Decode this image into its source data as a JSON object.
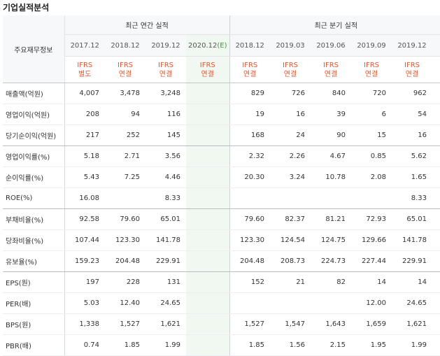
{
  "title": "기업실적분석",
  "header": {
    "rowhead": "주요재무정보",
    "annual_label": "최근 연간 실적",
    "quarter_label": "최근 분기 실적",
    "periods": [
      "2017.12",
      "2018.12",
      "2019.12",
      "2020.12",
      "2018.12",
      "2019.03",
      "2019.06",
      "2019.09",
      "2019.12"
    ],
    "est_mark": "(E)",
    "acc_top": "IFRS",
    "accounts": [
      "별도",
      "연결",
      "연결",
      "연결",
      "연결",
      "연결",
      "연결",
      "연결",
      "연결"
    ]
  },
  "rows": [
    {
      "label": "매출액(억원)",
      "values": [
        "4,007",
        "3,478",
        "3,248",
        "",
        "829",
        "726",
        "840",
        "720",
        "962"
      ]
    },
    {
      "label": "영업이익(억원)",
      "values": [
        "208",
        "94",
        "116",
        "",
        "19",
        "16",
        "39",
        "6",
        "54"
      ]
    },
    {
      "label": "당기순이익(억원)",
      "values": [
        "217",
        "252",
        "145",
        "",
        "168",
        "24",
        "90",
        "15",
        "16"
      ]
    },
    {
      "label": "영업이익률(%)",
      "values": [
        "5.18",
        "2.71",
        "3.56",
        "",
        "2.32",
        "2.26",
        "4.67",
        "0.85",
        "5.62"
      ]
    },
    {
      "label": "순이익률(%)",
      "values": [
        "5.43",
        "7.25",
        "4.46",
        "",
        "20.30",
        "3.24",
        "10.78",
        "2.08",
        "1.65"
      ]
    },
    {
      "label": "ROE(%)",
      "values": [
        "16.08",
        "",
        "8.33",
        "",
        "",
        "",
        "",
        "",
        "8.33"
      ]
    },
    {
      "label": "부채비율(%)",
      "values": [
        "92.58",
        "79.60",
        "65.01",
        "",
        "79.60",
        "82.37",
        "81.21",
        "72.93",
        "65.01"
      ]
    },
    {
      "label": "당좌비율(%)",
      "values": [
        "107.44",
        "123.30",
        "141.78",
        "",
        "123.30",
        "124.54",
        "124.75",
        "129.66",
        "141.78"
      ]
    },
    {
      "label": "유보율(%)",
      "values": [
        "159.23",
        "204.48",
        "229.91",
        "",
        "204.48",
        "208.73",
        "224.73",
        "227.44",
        "229.91"
      ]
    },
    {
      "label": "EPS(원)",
      "values": [
        "197",
        "228",
        "131",
        "",
        "152",
        "21",
        "82",
        "14",
        "14"
      ]
    },
    {
      "label": "PER(배)",
      "values": [
        "5.03",
        "12.40",
        "24.65",
        "",
        "",
        "",
        "",
        "12.00",
        "24.65"
      ]
    },
    {
      "label": "BPS(원)",
      "values": [
        "1,338",
        "1,527",
        "1,621",
        "",
        "1,527",
        "1,547",
        "1,643",
        "1,659",
        "1,621"
      ]
    },
    {
      "label": "PBR(배)",
      "values": [
        "0.74",
        "1.85",
        "1.99",
        "",
        "1.85",
        "1.56",
        "2.15",
        "1.95",
        "1.99"
      ]
    }
  ]
}
